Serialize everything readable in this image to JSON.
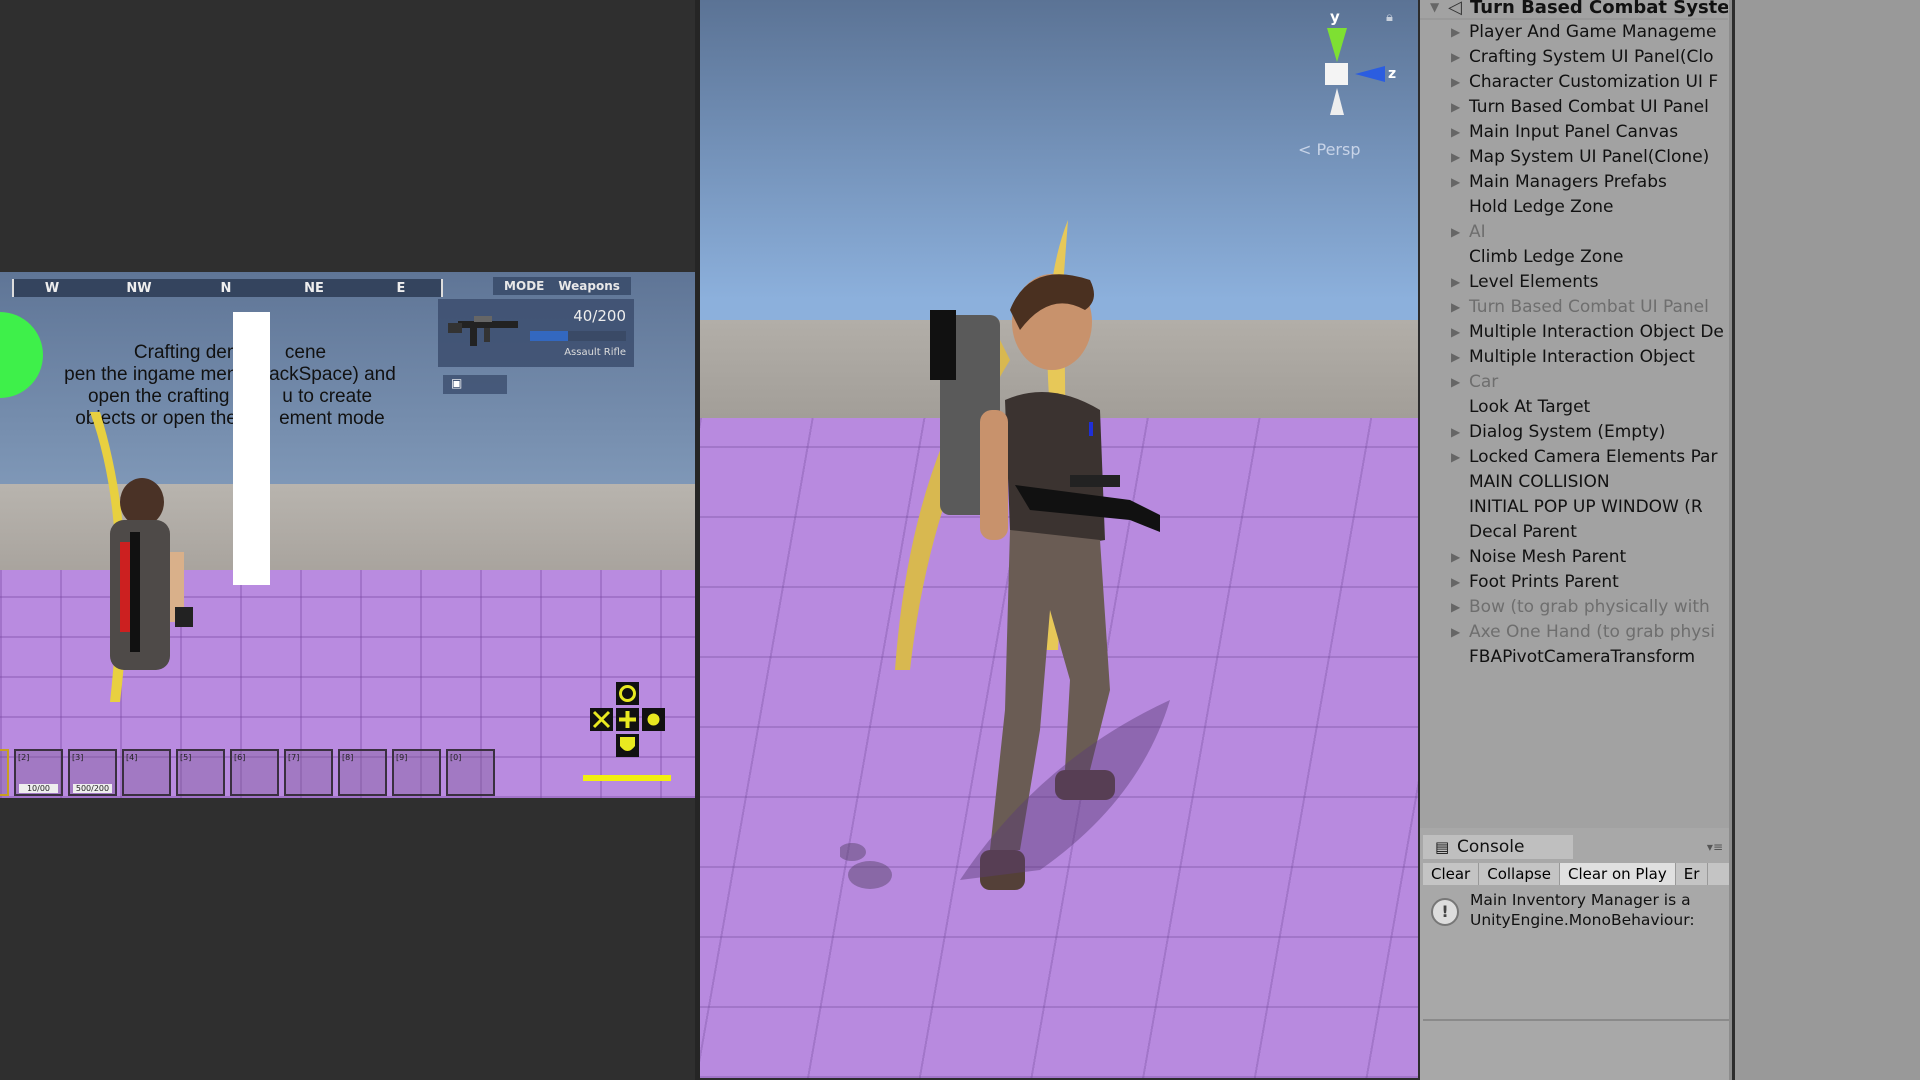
{
  "game_view": {
    "compass": [
      "W",
      "NW",
      "N",
      "NE",
      "E"
    ],
    "mode_label": "MODE",
    "mode_value": "Weapons",
    "weapon": {
      "ammo": "40/200",
      "name": "Assault Rifle",
      "ammo_fraction": 0.4
    },
    "crafting_text": [
      "Crafting dem        cene",
      "pen the ingame men      ackSpace) and",
      "open the crafting m      u to create",
      "objects or open the        ement mode"
    ],
    "hotbar": [
      {
        "label": "[2]",
        "count": "10/00"
      },
      {
        "label": "[3]",
        "count": "500/200"
      },
      {
        "label": "[4]",
        "count": ""
      },
      {
        "label": "[5]",
        "count": ""
      },
      {
        "label": "[6]",
        "count": ""
      },
      {
        "label": "[7]",
        "count": ""
      },
      {
        "label": "[8]",
        "count": ""
      },
      {
        "label": "[9]",
        "count": ""
      },
      {
        "label": "[0]",
        "count": ""
      }
    ],
    "health_fraction": 1.0
  },
  "scene_view": {
    "gizmo_y": "y",
    "gizmo_z": "z",
    "projection": "Persp"
  },
  "hierarchy": {
    "root": "Turn Based Combat Syste",
    "items": [
      {
        "label": "Player And Game Manageme",
        "arrow": true,
        "dim": false
      },
      {
        "label": "Crafting System UI Panel(Clo",
        "arrow": true,
        "dim": false
      },
      {
        "label": "Character Customization UI F",
        "arrow": true,
        "dim": false
      },
      {
        "label": "Turn Based Combat UI Panel",
        "arrow": true,
        "dim": false
      },
      {
        "label": "Main Input Panel Canvas",
        "arrow": true,
        "dim": false
      },
      {
        "label": "Map System UI Panel(Clone)",
        "arrow": true,
        "dim": false
      },
      {
        "label": "Main Managers Prefabs",
        "arrow": true,
        "dim": false
      },
      {
        "label": "Hold Ledge Zone",
        "arrow": false,
        "dim": false
      },
      {
        "label": "AI",
        "arrow": true,
        "dim": true
      },
      {
        "label": "Climb Ledge Zone",
        "arrow": false,
        "dim": false
      },
      {
        "label": "Level Elements",
        "arrow": true,
        "dim": false
      },
      {
        "label": "Turn Based Combat UI Panel",
        "arrow": true,
        "dim": true
      },
      {
        "label": "Multiple Interaction Object De",
        "arrow": true,
        "dim": false
      },
      {
        "label": "Multiple Interaction Object",
        "arrow": true,
        "dim": false
      },
      {
        "label": "Car",
        "arrow": true,
        "dim": true
      },
      {
        "label": "Look At Target",
        "arrow": false,
        "dim": false
      },
      {
        "label": "Dialog System (Empty)",
        "arrow": true,
        "dim": false
      },
      {
        "label": "Locked Camera Elements Par",
        "arrow": true,
        "dim": false
      },
      {
        "label": "MAIN COLLISION",
        "arrow": false,
        "dim": false
      },
      {
        "label": "INITIAL POP UP WINDOW (R",
        "arrow": false,
        "dim": false
      },
      {
        "label": "Decal Parent",
        "arrow": false,
        "dim": false
      },
      {
        "label": "Noise Mesh Parent",
        "arrow": true,
        "dim": false
      },
      {
        "label": "Foot Prints Parent",
        "arrow": true,
        "dim": false
      },
      {
        "label": "Bow (to grab physically with",
        "arrow": true,
        "dim": true
      },
      {
        "label": "Axe One Hand (to grab physi",
        "arrow": true,
        "dim": true
      },
      {
        "label": "FBAPivotCameraTransform",
        "arrow": false,
        "dim": false
      }
    ]
  },
  "console": {
    "tab": "Console",
    "buttons": [
      "Clear",
      "Collapse",
      "Clear on Play",
      "Er"
    ],
    "message_line1": "Main Inventory Manager is a",
    "message_line2": "UnityEngine.MonoBehaviour:"
  }
}
